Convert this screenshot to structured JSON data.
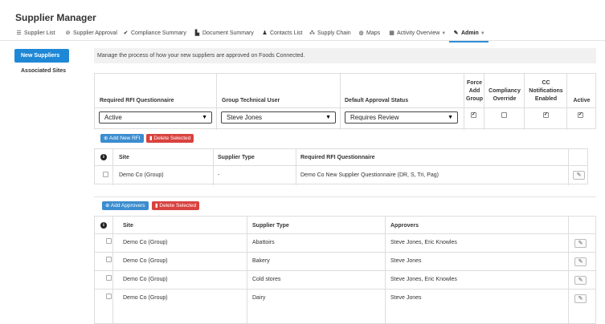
{
  "app_title": "Supplier Manager",
  "nav": [
    {
      "label": "Supplier List",
      "icon": "list-icon",
      "glyph": "☰"
    },
    {
      "label": "Supplier Approval",
      "icon": "check-circle-icon",
      "glyph": "⊘"
    },
    {
      "label": "Compliance Summary",
      "icon": "checkmark-icon",
      "glyph": "✔"
    },
    {
      "label": "Document Summary",
      "icon": "document-icon",
      "glyph": "▙"
    },
    {
      "label": "Contacts List",
      "icon": "user-icon",
      "glyph": "♟"
    },
    {
      "label": "Supply Chain",
      "icon": "sitemap-icon",
      "glyph": "⁂"
    },
    {
      "label": "Maps",
      "icon": "globe-icon",
      "glyph": "◍"
    },
    {
      "label": "Activity Overview",
      "icon": "calendar-icon",
      "glyph": "▦"
    },
    {
      "label": "Admin",
      "icon": "wrench-icon",
      "glyph": "✎"
    }
  ],
  "sidebar": {
    "items": [
      {
        "label": "New Suppliers"
      },
      {
        "label": "Associated Sites"
      }
    ]
  },
  "info_text": "Manage the process of how your new suppliers are approved on Foods Connected.",
  "rfi_settings": {
    "headers": {
      "questionnaire": "Required RFI Questionnaire",
      "technical_user": "Group Technical User",
      "approval_status": "Default Approval Status",
      "force_add_group": [
        "Force",
        "Add",
        "Group"
      ],
      "compliancy_override": [
        "Compliancy",
        "Override"
      ],
      "cc_notifications": [
        "CC",
        "Notifications",
        "Enabled"
      ],
      "active": "Active"
    },
    "questionnaire_value": "Active",
    "technical_user_value": "Steve Jones",
    "approval_status_value": "Requires Review",
    "force_add_group_checked": true,
    "compliancy_override_checked": false,
    "cc_notifications_checked": true,
    "active_checked": true
  },
  "rfi_buttons": {
    "add": "Add New RFI",
    "delete": "Delete Selected"
  },
  "rfi_table": {
    "headers": {
      "site": "Site",
      "supplier_type": "Supplier Type",
      "questionnaire": "Required RFI Questionnaire"
    },
    "rows": [
      {
        "site": "Demo Co (Group)",
        "supplier_type": "-",
        "questionnaire": "Demo Co New Supplier Questionnaire (DR, S, Tri, Pag)"
      }
    ]
  },
  "approver_buttons": {
    "add": "Add Approvers",
    "delete": "Delete Selected"
  },
  "approver_table": {
    "headers": {
      "site": "Site",
      "supplier_type": "Supplier Type",
      "approvers": "Approvers"
    },
    "rows": [
      {
        "site": "Demo Co (Group)",
        "supplier_type": "Abattoirs",
        "approvers": "Steve Jones, Eric Knowles"
      },
      {
        "site": "Demo Co (Group)",
        "supplier_type": "Bakery",
        "approvers": "Steve Jones"
      },
      {
        "site": "Demo Co (Group)",
        "supplier_type": "Cold stores",
        "approvers": "Steve Jones, Eric Knowles"
      },
      {
        "site": "Demo Co (Group)",
        "supplier_type": "Dairy",
        "approvers": "Steve Jones"
      }
    ]
  },
  "colors": {
    "accent": "#1f88d6",
    "danger": "#d9423e",
    "primary_button": "#3c8dcf"
  }
}
